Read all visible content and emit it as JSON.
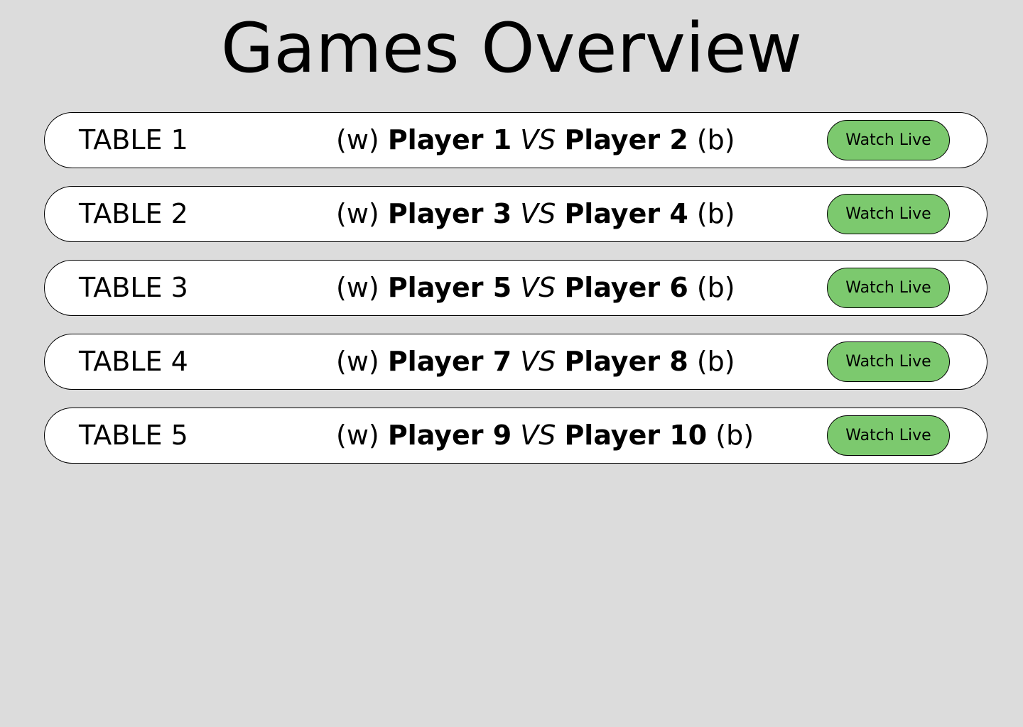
{
  "page": {
    "title": "Games Overview"
  },
  "colors": {
    "background": "#dcdcdc",
    "row_background": "#ffffff",
    "button_green": "#7cc96e"
  },
  "games": [
    {
      "table": "TABLE 1",
      "white_marker": "(w)",
      "white_player": "Player 1",
      "vs": "VS",
      "black_player": "Player 2",
      "black_marker": "(b)",
      "button_label": "Watch Live"
    },
    {
      "table": "TABLE 2",
      "white_marker": "(w)",
      "white_player": "Player 3",
      "vs": "VS",
      "black_player": "Player 4",
      "black_marker": "(b)",
      "button_label": "Watch Live"
    },
    {
      "table": "TABLE 3",
      "white_marker": "(w)",
      "white_player": "Player 5",
      "vs": "VS",
      "black_player": "Player 6",
      "black_marker": "(b)",
      "button_label": "Watch Live"
    },
    {
      "table": "TABLE 4",
      "white_marker": "(w)",
      "white_player": "Player 7",
      "vs": "VS",
      "black_player": "Player 8",
      "black_marker": "(b)",
      "button_label": "Watch Live"
    },
    {
      "table": "TABLE 5",
      "white_marker": "(w)",
      "white_player": "Player 9",
      "vs": "VS",
      "black_player": "Player 10",
      "black_marker": "(b)",
      "button_label": "Watch Live"
    }
  ]
}
